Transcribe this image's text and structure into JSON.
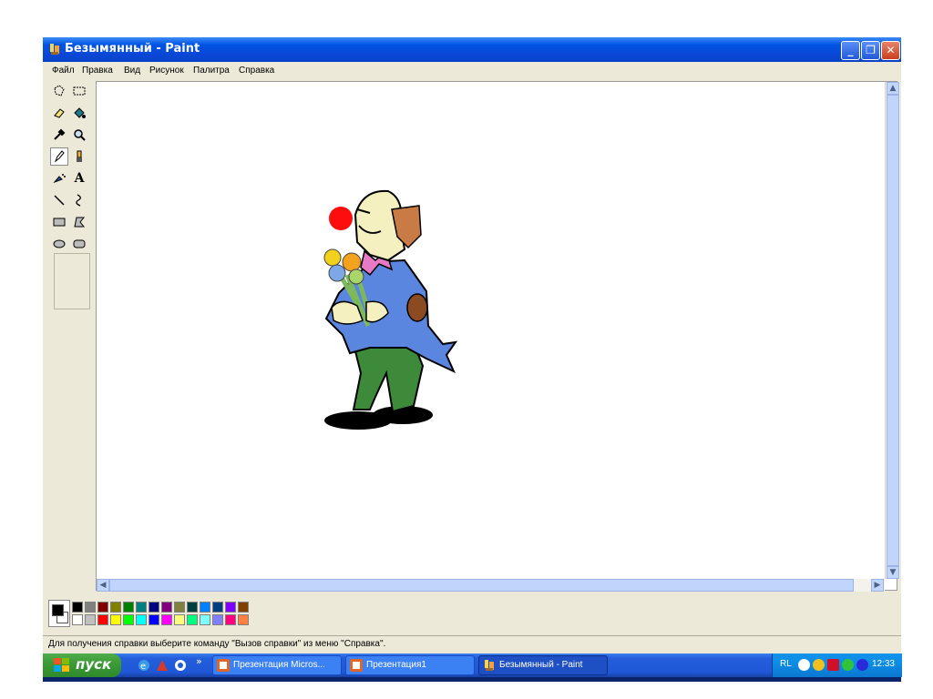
{
  "window": {
    "title": "Безымянный - Paint",
    "minimize_glyph": "_",
    "maximize_glyph": "❐",
    "close_glyph": "✕"
  },
  "menu": [
    "Файл",
    "Правка",
    "Вид",
    "Рисунок",
    "Палитра",
    "Справка"
  ],
  "tools": [
    {
      "name": "free-form-select-icon"
    },
    {
      "name": "rect-select-icon"
    },
    {
      "name": "eraser-icon"
    },
    {
      "name": "fill-bucket-icon"
    },
    {
      "name": "color-picker-icon"
    },
    {
      "name": "magnifier-icon"
    },
    {
      "name": "pencil-icon",
      "selected": true
    },
    {
      "name": "brush-icon"
    },
    {
      "name": "airbrush-icon"
    },
    {
      "name": "text-icon",
      "glyph": "A"
    },
    {
      "name": "line-icon"
    },
    {
      "name": "curve-icon"
    },
    {
      "name": "rectangle-icon"
    },
    {
      "name": "polygon-icon"
    },
    {
      "name": "ellipse-icon"
    },
    {
      "name": "rounded-rect-icon"
    }
  ],
  "palette": {
    "foreground": "#000000",
    "background": "#ffffff",
    "top_row": [
      "#000000",
      "#808080",
      "#800000",
      "#808000",
      "#008000",
      "#008080",
      "#000080",
      "#800080",
      "#808040",
      "#004040",
      "#0080ff",
      "#004080",
      "#8000ff",
      "#804000"
    ],
    "bottom_row": [
      "#ffffff",
      "#c0c0c0",
      "#ff0000",
      "#ffff00",
      "#00ff00",
      "#00ffff",
      "#0000ff",
      "#ff00ff",
      "#ffff80",
      "#00ff80",
      "#80ffff",
      "#8080ff",
      "#ff0080",
      "#ff8040"
    ]
  },
  "status": {
    "text": "Для получения справки выберите команду \"Вызов справки\" из меню \"Справка\"."
  },
  "taskbar": {
    "start_label": "пуск",
    "chevron": "»",
    "tasks": [
      {
        "label": "Презентация Micros...",
        "active": false
      },
      {
        "label": "Презентация1",
        "active": false
      },
      {
        "label": "Безымянный - Paint",
        "active": true
      }
    ],
    "lang": "RL",
    "time": "12:33"
  }
}
